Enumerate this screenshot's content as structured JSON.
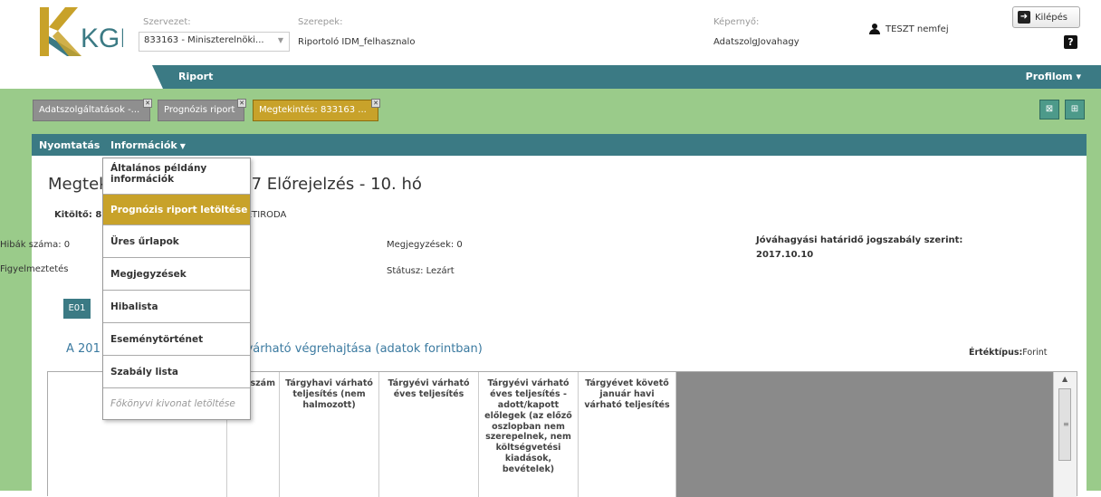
{
  "header": {
    "logo": "KGR",
    "org_label": "Szervezet:",
    "org_value": "833163 - Miniszterelnöki...",
    "roles_label": "Szerepek:",
    "roles_value": "Riportoló IDM_felhasznalo",
    "screen_label": "Képernyő:",
    "screen_value": "AdatszolgJovahagy",
    "user_name": "TESZT nemfej",
    "logout_label": "Kilépés",
    "help_label": "?"
  },
  "nav": {
    "riport": "Riport",
    "profilom": "Profilom ▾"
  },
  "tabs": [
    {
      "label": "Adatszolgáltatások -..."
    },
    {
      "label": "Prognózis riport"
    },
    {
      "label": "Megtekintés: 833163 ..."
    }
  ],
  "panel": {
    "menu_print": "Nyomtatás",
    "menu_info": "Információk",
    "title_left": "Megtek",
    "title_right": "7 Előrejelzés - 10. hó",
    "kitolto_label": "Kitöltő: 8",
    "kitolto_right": "NETIRODA",
    "errors_label": "Hibák száma: 0",
    "warnings_label": "Figyelmeztetés",
    "notes_label": "Megjegyzések: 0",
    "status_label": "Státusz: Lezárt",
    "deadline_label": "Jóváhagyási határidő jogszabály szerint:",
    "deadline_value": "2017.10.10",
    "form_tab": "E01",
    "subtitle_left": "A 201",
    "subtitle_right": "j várható végrehajtása (adatok forintban)",
    "value_type_label": "Értéktípus:",
    "value_type_value": "Forint",
    "columns": [
      "szám",
      "Tárgyhavi várható teljesítés (nem halmozott)",
      "Tárgyévi várható éves teljesítés",
      "Tárgyévi várható éves teljesítés - adott/kapott előlegek (az előző oszlopban nem szerepelnek, nem költségvetési kiadások, bevételek)",
      "Tárgyévet követő január havi várható teljesítés"
    ]
  },
  "dropdown": {
    "items": [
      {
        "label": "Általános példány információk"
      },
      {
        "label": "Prognózis riport letöltése"
      },
      {
        "label": "Üres űrlapok"
      },
      {
        "label": "Megjegyzések"
      },
      {
        "label": "Hibalista"
      },
      {
        "label": "Eseménytörténet"
      },
      {
        "label": "Szabály lista"
      },
      {
        "label": "Főkönyvi kivonat letöltése"
      }
    ]
  },
  "colors": {
    "teal": "#3b7a84",
    "gold": "#c8a22a",
    "green_bg": "#9acb8a"
  }
}
